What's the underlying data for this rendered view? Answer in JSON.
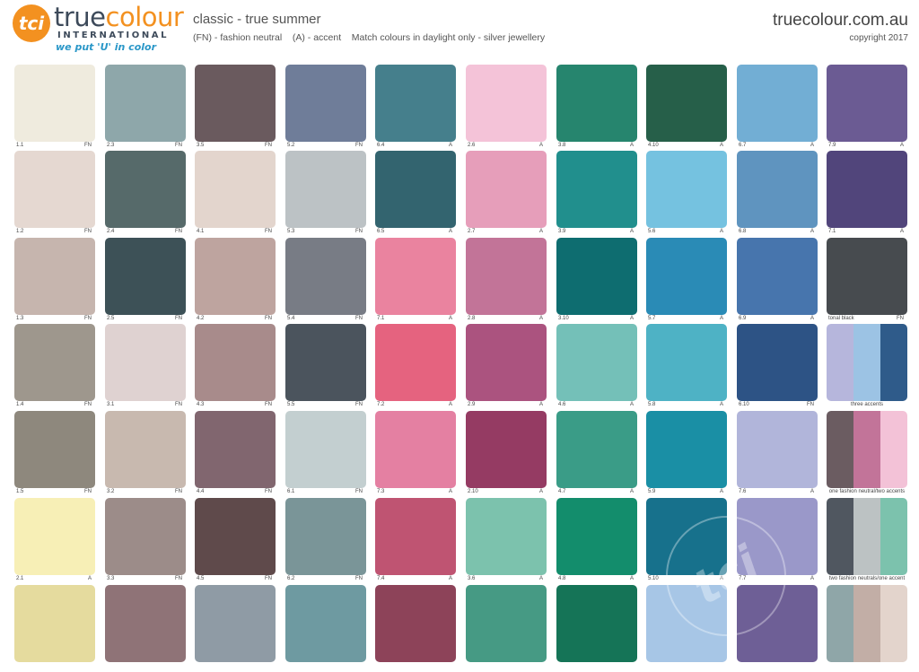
{
  "brand": {
    "logo_mark": "tci",
    "name_part1": "true",
    "name_part2": "colour",
    "sub": "INTERNATIONAL",
    "tagline": "we put 'U' in color"
  },
  "header": {
    "title": "classic - true summer",
    "subtitle": "(FN) - fashion neutral    (A) - accent    Match colours in daylight only - silver jewellery",
    "site": "truecolour.com.au",
    "copyright": "copyright 2017"
  },
  "columns": [
    [
      {
        "label": "1.1",
        "type": "FN",
        "colors": [
          "#efebde"
        ]
      },
      {
        "label": "1.2",
        "type": "FN",
        "colors": [
          "#e5d8d1"
        ]
      },
      {
        "label": "1.3",
        "type": "FN",
        "colors": [
          "#c6b5ae"
        ]
      },
      {
        "label": "1.4",
        "type": "FN",
        "colors": [
          "#9e978d"
        ]
      },
      {
        "label": "1.5",
        "type": "FN",
        "colors": [
          "#8e887d"
        ]
      },
      {
        "label": "2.1",
        "type": "A",
        "colors": [
          "#f7efb6"
        ]
      },
      {
        "label": "",
        "type": "",
        "colors": [
          "#e5db9e"
        ]
      }
    ],
    [
      {
        "label": "2.3",
        "type": "FN",
        "colors": [
          "#8ea7aa"
        ]
      },
      {
        "label": "2.4",
        "type": "FN",
        "colors": [
          "#566a6a"
        ]
      },
      {
        "label": "2.5",
        "type": "FN",
        "colors": [
          "#3d5157"
        ]
      },
      {
        "label": "3.1",
        "type": "FN",
        "colors": [
          "#dfd2d1"
        ]
      },
      {
        "label": "3.2",
        "type": "FN",
        "colors": [
          "#c8b9af"
        ]
      },
      {
        "label": "3.3",
        "type": "FN",
        "colors": [
          "#9c8c89"
        ]
      },
      {
        "label": "",
        "type": "",
        "colors": [
          "#8f7377"
        ]
      }
    ],
    [
      {
        "label": "3.5",
        "type": "FN",
        "colors": [
          "#6a5a5e"
        ]
      },
      {
        "label": "4.1",
        "type": "FN",
        "colors": [
          "#e3d5cd"
        ]
      },
      {
        "label": "4.2",
        "type": "FN",
        "colors": [
          "#bea49f"
        ]
      },
      {
        "label": "4.3",
        "type": "FN",
        "colors": [
          "#a88b8b"
        ]
      },
      {
        "label": "4.4",
        "type": "FN",
        "colors": [
          "#81666f"
        ]
      },
      {
        "label": "4.5",
        "type": "FN",
        "colors": [
          "#5f4a4b"
        ]
      },
      {
        "label": "",
        "type": "",
        "colors": [
          "#8f9ba5"
        ]
      }
    ],
    [
      {
        "label": "5.2",
        "type": "FN",
        "colors": [
          "#6f7d99"
        ]
      },
      {
        "label": "5.3",
        "type": "FN",
        "colors": [
          "#bcc2c5"
        ]
      },
      {
        "label": "5.4",
        "type": "FN",
        "colors": [
          "#787c85"
        ]
      },
      {
        "label": "5.5",
        "type": "FN",
        "colors": [
          "#4b545d"
        ]
      },
      {
        "label": "6.1",
        "type": "FN",
        "colors": [
          "#c3cfd0"
        ]
      },
      {
        "label": "6.2",
        "type": "FN",
        "colors": [
          "#7a9598"
        ]
      },
      {
        "label": "",
        "type": "",
        "colors": [
          "#6e9aa1"
        ]
      }
    ],
    [
      {
        "label": "6.4",
        "type": "A",
        "colors": [
          "#457f8c"
        ]
      },
      {
        "label": "6.5",
        "type": "A",
        "colors": [
          "#33646f"
        ]
      },
      {
        "label": "7.1",
        "type": "A",
        "colors": [
          "#ea839f"
        ]
      },
      {
        "label": "7.2",
        "type": "A",
        "colors": [
          "#e5637f"
        ]
      },
      {
        "label": "7.3",
        "type": "A",
        "colors": [
          "#e480a2"
        ]
      },
      {
        "label": "7.4",
        "type": "A",
        "colors": [
          "#bf5472"
        ]
      },
      {
        "label": "",
        "type": "",
        "colors": [
          "#8d4359"
        ]
      }
    ],
    [
      {
        "label": "2.6",
        "type": "A",
        "colors": [
          "#f4c3d8"
        ]
      },
      {
        "label": "2.7",
        "type": "A",
        "colors": [
          "#e69eba"
        ]
      },
      {
        "label": "2.8",
        "type": "A",
        "colors": [
          "#c27498"
        ]
      },
      {
        "label": "2.9",
        "type": "A",
        "colors": [
          "#ab537f"
        ]
      },
      {
        "label": "2.10",
        "type": "A",
        "colors": [
          "#953b63"
        ]
      },
      {
        "label": "3.6",
        "type": "A",
        "colors": [
          "#7cc2ad"
        ]
      },
      {
        "label": "",
        "type": "",
        "colors": [
          "#469a84"
        ]
      }
    ],
    [
      {
        "label": "3.8",
        "type": "A",
        "colors": [
          "#26856e"
        ]
      },
      {
        "label": "3.9",
        "type": "A",
        "colors": [
          "#218f8d"
        ]
      },
      {
        "label": "3.10",
        "type": "A",
        "colors": [
          "#0e6d70"
        ]
      },
      {
        "label": "4.6",
        "type": "A",
        "colors": [
          "#74c0b8"
        ]
      },
      {
        "label": "4.7",
        "type": "A",
        "colors": [
          "#3a9c87"
        ]
      },
      {
        "label": "4.8",
        "type": "A",
        "colors": [
          "#138d6c"
        ]
      },
      {
        "label": "",
        "type": "",
        "colors": [
          "#157457"
        ]
      }
    ],
    [
      {
        "label": "4.10",
        "type": "A",
        "colors": [
          "#265f49"
        ]
      },
      {
        "label": "5.6",
        "type": "A",
        "colors": [
          "#75c2e0"
        ]
      },
      {
        "label": "5.7",
        "type": "A",
        "colors": [
          "#2a8bb6"
        ]
      },
      {
        "label": "5.8",
        "type": "A",
        "colors": [
          "#4eb2c5"
        ]
      },
      {
        "label": "5.9",
        "type": "A",
        "colors": [
          "#1a8fa5"
        ]
      },
      {
        "label": "5.10",
        "type": "A",
        "colors": [
          "#17718c"
        ]
      },
      {
        "label": "",
        "type": "",
        "colors": [
          "#a7c6e6"
        ]
      }
    ],
    [
      {
        "label": "6.7",
        "type": "A",
        "colors": [
          "#72aed4"
        ]
      },
      {
        "label": "6.8",
        "type": "A",
        "colors": [
          "#5f94bf"
        ]
      },
      {
        "label": "6.9",
        "type": "A",
        "colors": [
          "#4775ad"
        ]
      },
      {
        "label": "6.10",
        "type": "FN",
        "colors": [
          "#2d5385"
        ]
      },
      {
        "label": "7.6",
        "type": "A",
        "colors": [
          "#b1b5da"
        ]
      },
      {
        "label": "7.7",
        "type": "A",
        "colors": [
          "#9a98c9"
        ]
      },
      {
        "label": "",
        "type": "",
        "colors": [
          "#6e5f96"
        ]
      }
    ],
    [
      {
        "label": "7.9",
        "type": "A",
        "colors": [
          "#6b5b93"
        ]
      },
      {
        "label": "7.1",
        "type": "A",
        "colors": [
          "#51457b"
        ]
      },
      {
        "label": "tonal black",
        "type": "FN",
        "colors": [
          "#474b4f"
        ]
      },
      {
        "label": "three accents",
        "type": "",
        "colors": [
          "#b6b6dc",
          "#9cc3e4",
          "#2f5b8a"
        ]
      },
      {
        "label": "one fashion neutral/two accents",
        "type": "",
        "colors": [
          "#6b5c61",
          "#c27499",
          "#f3c2d7"
        ]
      },
      {
        "label": "two fashion neutrals/one accent",
        "type": "",
        "colors": [
          "#505760",
          "#bcc2c3",
          "#7cc2ad"
        ]
      },
      {
        "label": "",
        "type": "",
        "colors": [
          "#8fa6a8",
          "#c2aea6",
          "#e3d4cc"
        ]
      }
    ]
  ]
}
